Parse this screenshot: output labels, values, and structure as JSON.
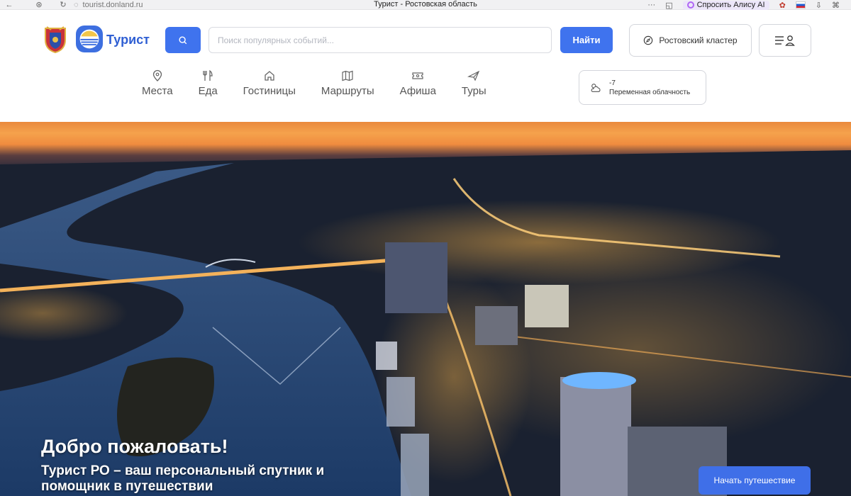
{
  "browser": {
    "url": "tourist.donland.ru",
    "tab_title": "Турист - Ростовская область",
    "ai_button": "Спросить Алису AI"
  },
  "header": {
    "brand": "Турист",
    "search": {
      "placeholder": "Поиск популярных событий..."
    },
    "find_button": "Найти",
    "cluster_button": "Ростовский кластер"
  },
  "nav": {
    "items": [
      {
        "label": "Места",
        "icon": "map-pin-icon"
      },
      {
        "label": "Еда",
        "icon": "utensils-icon"
      },
      {
        "label": "Гостиницы",
        "icon": "home-icon"
      },
      {
        "label": "Маршруты",
        "icon": "map-icon"
      },
      {
        "label": "Афиша",
        "icon": "ticket-icon"
      },
      {
        "label": "Туры",
        "icon": "plane-icon"
      }
    ]
  },
  "weather": {
    "temperature": "-7",
    "condition": "Переменная облачность"
  },
  "hero": {
    "title": "Добро пожаловать!",
    "subtitle": "Турист РО – ваш персональный спутник и помощник в путешествии",
    "cta": "Начать путешествие"
  },
  "colors": {
    "accent": "#3f73ee",
    "brand_text": "#2f5fd3"
  }
}
